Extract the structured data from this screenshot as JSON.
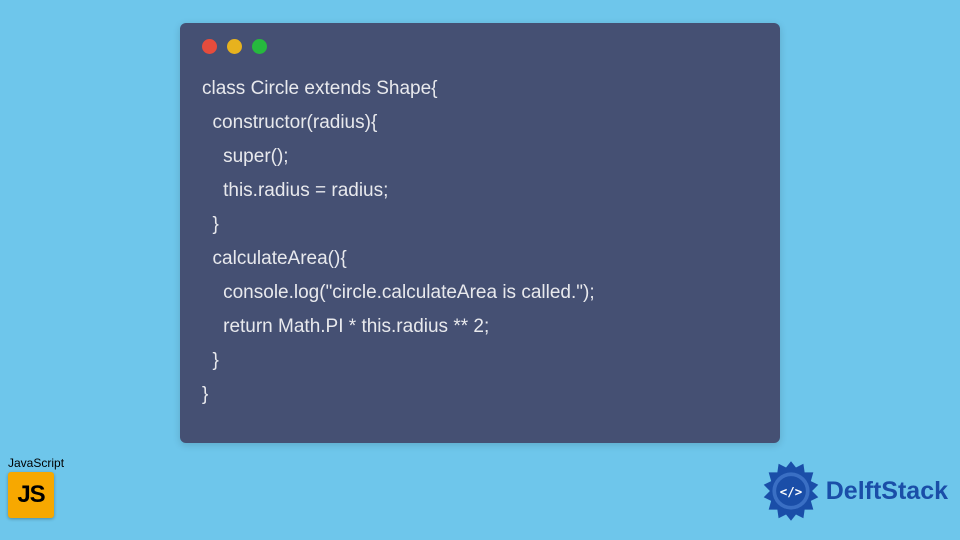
{
  "code": {
    "lines": [
      "class Circle extends Shape{",
      "  constructor(radius){",
      "    super();",
      "    this.radius = radius;",
      "  }",
      "  calculateArea(){",
      "    console.log(\"circle.calculateArea is called.\");",
      "    return Math.PI * this.radius ** 2;",
      "  }",
      "}"
    ]
  },
  "js_badge": {
    "label": "JavaScript",
    "icon_text": "JS"
  },
  "brand": {
    "name": "DelftStack"
  }
}
